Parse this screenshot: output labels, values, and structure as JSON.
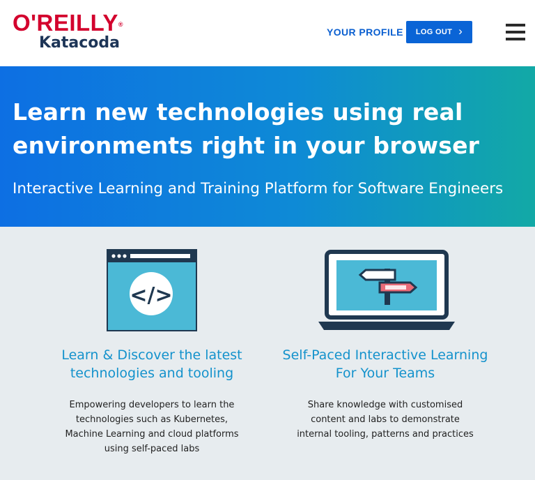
{
  "header": {
    "logo_brand": "O'REILLY",
    "logo_product": "Katacoda",
    "profile_label": "YOUR PROFILE",
    "logout_label": "LOG OUT",
    "menu_icon": "hamburger-menu-icon"
  },
  "hero": {
    "title": "Learn new technologies using real environments right in your browser",
    "subtitle": "Interactive Learning and Training Platform for Software Engineers"
  },
  "features": [
    {
      "icon": "code-window-icon",
      "title": "Learn & Discover the latest technologies and tooling",
      "description": "Empowering developers to learn the technologies such as Kubernetes, Machine Learning and cloud platforms using self-paced labs"
    },
    {
      "icon": "laptop-signpost-icon",
      "title": "Self-Paced Interactive Learning For Your Teams",
      "description": "Share knowledge with customised content and labs to demonstrate internal tooling, patterns and practices"
    }
  ],
  "colors": {
    "brand_red": "#d3002d",
    "link_blue": "#0a5fd0",
    "accent_teal": "#1492cc"
  }
}
